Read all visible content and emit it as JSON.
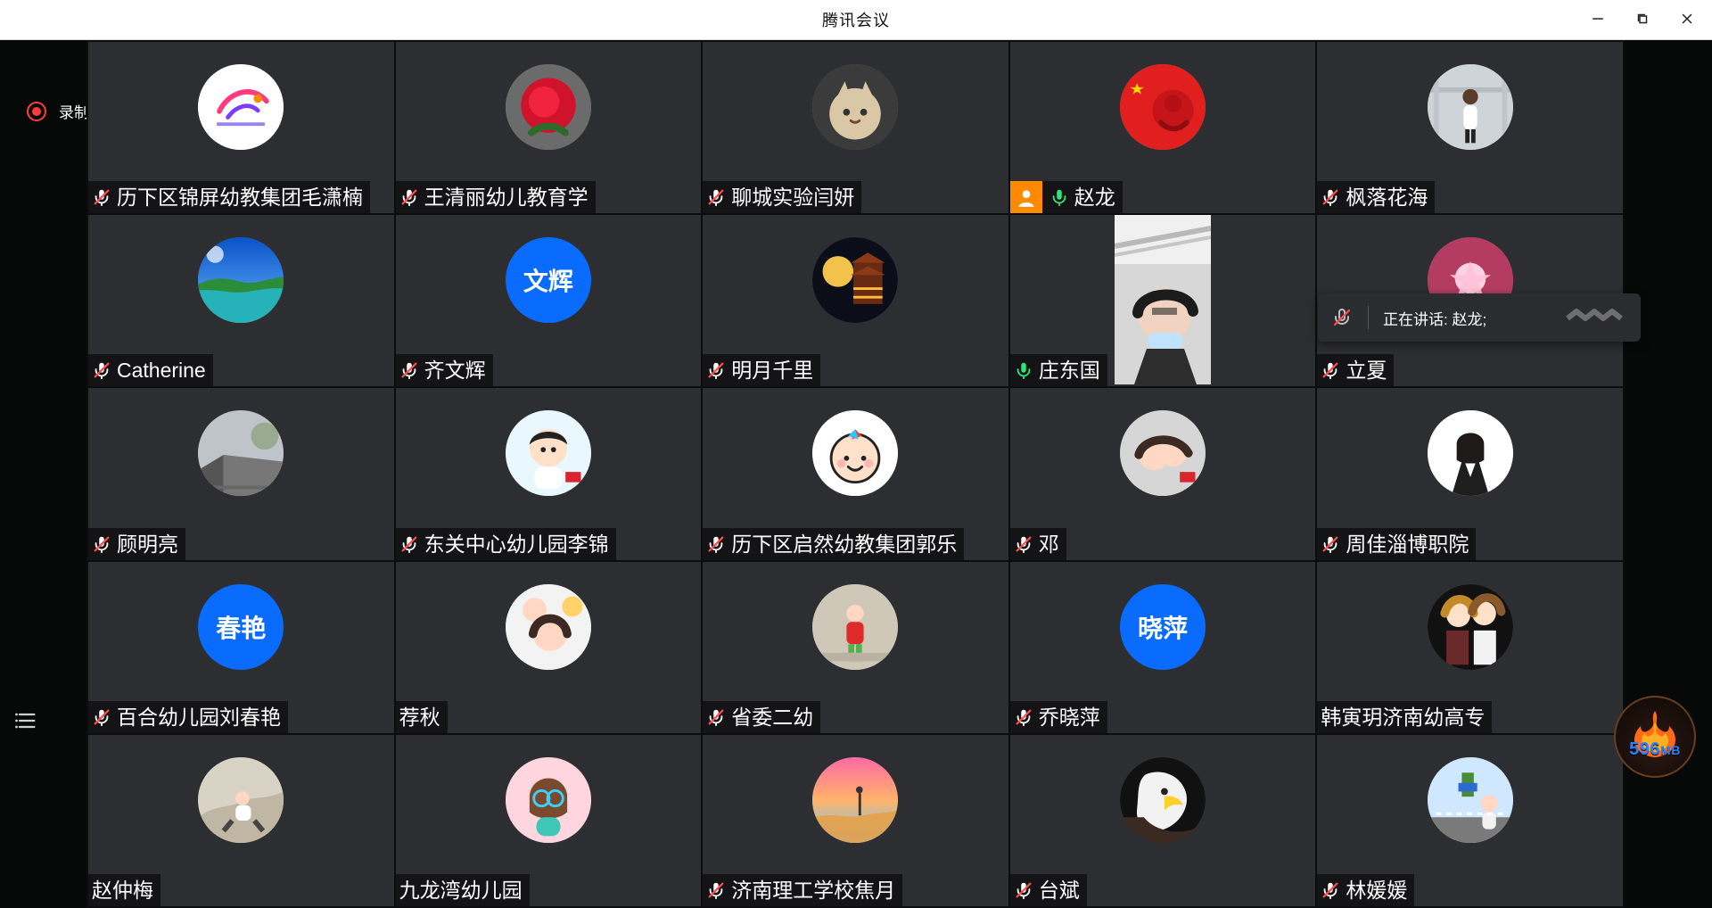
{
  "window": {
    "title": "腾讯会议",
    "controls": {
      "minimize": "minimize",
      "restore": "restore",
      "close": "close"
    }
  },
  "recording": {
    "label": "录制中",
    "color": "#ff3b3b"
  },
  "speaking": {
    "label": "正在讲话: 赵龙;"
  },
  "memory_widget": {
    "value": "596",
    "unit": "MB"
  },
  "participants": [
    {
      "name": "历下区锦屏幼教集团毛潇楠",
      "mic": "muted",
      "avatar": {
        "type": "image",
        "icon": "logo-avatar"
      }
    },
    {
      "name": "王清丽幼儿教育学",
      "mic": "muted",
      "avatar": {
        "type": "image",
        "icon": "rose-avatar"
      }
    },
    {
      "name": "聊城实验闫妍",
      "mic": "muted",
      "avatar": {
        "type": "image",
        "icon": "cat-avatar"
      }
    },
    {
      "name": "赵龙",
      "mic": "on",
      "badge": "host-icon",
      "avatar": {
        "type": "image",
        "icon": "flag-avatar"
      }
    },
    {
      "name": "枫落花海",
      "mic": "muted",
      "avatar": {
        "type": "image",
        "icon": "person-hall-avatar"
      }
    },
    {
      "name": "Catherine",
      "mic": "muted",
      "avatar": {
        "type": "image",
        "icon": "lake-avatar"
      }
    },
    {
      "name": "齐文辉",
      "mic": "muted",
      "avatar": {
        "type": "text",
        "text": "文辉"
      }
    },
    {
      "name": "明月千里",
      "mic": "muted",
      "avatar": {
        "type": "image",
        "icon": "moon-pagoda-avatar"
      }
    },
    {
      "name": "庄东国",
      "mic": "on",
      "avatar": {
        "type": "video",
        "icon": "camera-video"
      }
    },
    {
      "name": "立夏",
      "mic": "muted",
      "avatar": {
        "type": "image",
        "icon": "flower-avatar"
      }
    },
    {
      "name": "顾明亮",
      "mic": "muted",
      "avatar": {
        "type": "image",
        "icon": "building-avatar"
      }
    },
    {
      "name": "东关中心幼儿园李锦",
      "mic": "muted",
      "avatar": {
        "type": "image",
        "icon": "cartoon-man-avatar"
      }
    },
    {
      "name": "历下区启然幼教集团郭乐",
      "mic": "muted",
      "avatar": {
        "type": "image",
        "icon": "cartoon-face-avatar"
      }
    },
    {
      "name": "邓",
      "mic": "muted",
      "avatar": {
        "type": "image",
        "icon": "family-avatar"
      }
    },
    {
      "name": "周佳淄博职院",
      "mic": "muted",
      "avatar": {
        "type": "image",
        "icon": "woman-portrait-avatar"
      }
    },
    {
      "name": "百合幼儿园刘春艳",
      "mic": "muted",
      "avatar": {
        "type": "text",
        "text": "春艳"
      }
    },
    {
      "name": "荐秋",
      "mic": "none",
      "avatar": {
        "type": "image",
        "icon": "girl-collage-avatar"
      }
    },
    {
      "name": "省委二幼",
      "mic": "muted",
      "avatar": {
        "type": "image",
        "icon": "toddler-avatar"
      }
    },
    {
      "name": "乔晓萍",
      "mic": "muted",
      "avatar": {
        "type": "text",
        "text": "晓萍"
      }
    },
    {
      "name": "韩寅玥济南幼高专",
      "mic": "none",
      "avatar": {
        "type": "image",
        "icon": "anime-duo-avatar"
      }
    },
    {
      "name": "赵仲梅",
      "mic": "none",
      "avatar": {
        "type": "image",
        "icon": "child-rocks-avatar"
      }
    },
    {
      "name": "九龙湾幼儿园",
      "mic": "none",
      "avatar": {
        "type": "image",
        "icon": "cartoon-girl-avatar"
      }
    },
    {
      "name": "济南理工学校焦月",
      "mic": "muted",
      "avatar": {
        "type": "image",
        "icon": "sunset-avatar"
      }
    },
    {
      "name": "台斌",
      "mic": "muted",
      "avatar": {
        "type": "image",
        "icon": "eagle-avatar"
      }
    },
    {
      "name": "林媛媛",
      "mic": "muted",
      "avatar": {
        "type": "image",
        "icon": "street-avatar"
      }
    }
  ],
  "colors": {
    "accent": "#0a6cff",
    "tile": "#2d2e31",
    "mic_muted": "#ff4d4f",
    "mic_on": "#2fe37a"
  }
}
